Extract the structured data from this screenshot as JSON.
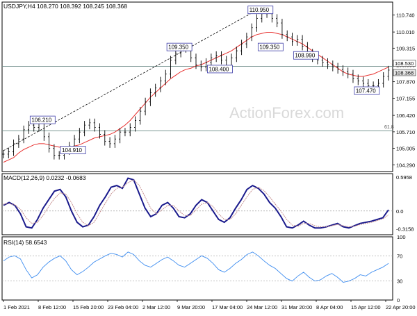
{
  "header": {
    "symbol_line": "USDJPY,H4  108.270 108.392 108.245 108.368",
    "watermark": "ActionForex.com"
  },
  "chart_data": [
    {
      "type": "candlestick",
      "panel": "price",
      "ylim": [
        104.29,
        110.74
      ],
      "y_ticks": [
        "110.740",
        "110.010",
        "109.315",
        "108.590",
        "107.870",
        "107.155",
        "106.420",
        "105.710",
        "105.005",
        "104.290"
      ],
      "price_labels": [
        "108.530",
        "108.368"
      ],
      "horizontal_lines": [
        {
          "value": 108.53,
          "color": "#6b8a86"
        },
        {
          "value": 105.76,
          "label": "61.8",
          "color": "#6b8a86"
        }
      ],
      "annotations": [
        {
          "text": "110.950",
          "x": "31 Mar",
          "value": 110.95
        },
        {
          "text": "109.350",
          "x": "3 Mar",
          "value": 109.35
        },
        {
          "text": "108.400",
          "x": "10 Mar",
          "value": 108.4
        },
        {
          "text": "109.350",
          "x": "1 Apr",
          "value": 109.35
        },
        {
          "text": "108.990",
          "x": "6 Apr",
          "value": 108.99
        },
        {
          "text": "107.470",
          "x": "23 Apr",
          "value": 107.47
        },
        {
          "text": "106.210",
          "x": "4 Feb",
          "value": 106.21
        },
        {
          "text": "104.910",
          "x": "12 Feb",
          "value": 104.91
        }
      ],
      "trendline": {
        "from": {
          "x": "1 Feb",
          "value": 104.9
        },
        "to": {
          "x": "30 Mar",
          "value": 110.95
        },
        "style": "dashed"
      },
      "series": [
        {
          "kind": "close",
          "color": "#000000",
          "values": [
            104.75,
            104.85,
            105.2,
            105.4,
            105.8,
            106.0,
            105.9,
            106.1,
            105.5,
            105.0,
            104.7,
            104.7,
            104.9,
            105.1,
            105.4,
            105.7,
            106.0,
            106.1,
            105.9,
            105.6,
            105.3,
            105.2,
            105.4,
            105.7,
            105.7,
            105.9,
            106.2,
            106.6,
            107.0,
            107.4,
            107.6,
            107.9,
            108.2,
            108.8,
            109.1,
            109.3,
            109.3,
            108.9,
            108.6,
            108.5,
            108.7,
            108.9,
            109.0,
            108.8,
            108.5,
            108.9,
            109.2,
            109.5,
            109.8,
            110.2,
            110.6,
            110.8,
            110.8,
            110.6,
            110.4,
            109.9,
            109.8,
            109.6,
            109.7,
            109.4,
            109.1,
            108.9,
            108.8,
            108.7,
            108.6,
            108.5,
            108.4,
            108.3,
            108.2,
            108.0,
            107.9,
            107.8,
            107.7,
            107.7,
            107.8,
            108.1,
            108.37
          ]
        },
        {
          "kind": "moving-average",
          "color": "#e8312f",
          "values": [
            104.4,
            104.5,
            104.6,
            104.8,
            104.95,
            105.05,
            105.15,
            105.2,
            105.2,
            105.15,
            105.1,
            105.05,
            105.05,
            105.05,
            105.1,
            105.15,
            105.25,
            105.35,
            105.45,
            105.5,
            105.55,
            105.6,
            105.7,
            105.85,
            106.0,
            106.2,
            106.45,
            106.7,
            106.95,
            107.2,
            107.4,
            107.6,
            107.8,
            108.0,
            108.15,
            108.3,
            108.4,
            108.45,
            108.55,
            108.6,
            108.7,
            108.8,
            108.9,
            109.0,
            109.1,
            109.2,
            109.35,
            109.5,
            109.65,
            109.8,
            109.9,
            109.95,
            110.0,
            110.0,
            109.95,
            109.9,
            109.8,
            109.7,
            109.6,
            109.5,
            109.35,
            109.2,
            109.05,
            108.9,
            108.75,
            108.6,
            108.45,
            108.3,
            108.2,
            108.15,
            108.1,
            108.1,
            108.15,
            108.2,
            108.3,
            108.4,
            108.5
          ]
        }
      ]
    },
    {
      "type": "line",
      "panel": "macd",
      "title": "MACD(12,26,9) 0.0232 -0.0683",
      "y_ticks": [
        "0.5958",
        "0.0",
        "-0.3158"
      ],
      "ylim": [
        -0.3158,
        0.5958
      ],
      "series": [
        {
          "kind": "macd",
          "color": "#1a1a8c",
          "values": [
            0.1,
            0.15,
            0.1,
            -0.05,
            -0.28,
            -0.3,
            -0.15,
            0.05,
            0.2,
            0.35,
            0.38,
            0.25,
            0.0,
            -0.2,
            -0.28,
            -0.25,
            -0.1,
            0.1,
            0.25,
            0.42,
            0.45,
            0.4,
            0.58,
            0.55,
            0.3,
            0.05,
            -0.1,
            -0.05,
            0.1,
            0.15,
            0.05,
            -0.1,
            -0.12,
            -0.05,
            0.1,
            0.2,
            0.15,
            0.0,
            -0.15,
            -0.2,
            -0.12,
            0.05,
            0.2,
            0.38,
            0.45,
            0.4,
            0.3,
            0.15,
            0.05,
            -0.1,
            -0.28,
            -0.3,
            -0.25,
            -0.18,
            -0.25,
            -0.3,
            -0.3,
            -0.28,
            -0.25,
            -0.22,
            -0.28,
            -0.3,
            -0.26,
            -0.22,
            -0.2,
            -0.18,
            -0.15,
            -0.12,
            0.02
          ]
        },
        {
          "kind": "signal",
          "color": "#c58f8f",
          "values": [
            0.12,
            0.13,
            0.11,
            0.03,
            -0.12,
            -0.22,
            -0.2,
            -0.08,
            0.08,
            0.22,
            0.32,
            0.3,
            0.15,
            -0.05,
            -0.2,
            -0.26,
            -0.2,
            -0.03,
            0.14,
            0.3,
            0.4,
            0.42,
            0.5,
            0.55,
            0.45,
            0.25,
            0.05,
            -0.05,
            0.02,
            0.1,
            0.1,
            0.0,
            -0.08,
            -0.08,
            0.02,
            0.12,
            0.15,
            0.08,
            -0.05,
            -0.15,
            -0.15,
            -0.05,
            0.1,
            0.25,
            0.38,
            0.42,
            0.36,
            0.25,
            0.12,
            0.0,
            -0.15,
            -0.25,
            -0.27,
            -0.22,
            -0.22,
            -0.26,
            -0.28,
            -0.28,
            -0.26,
            -0.24,
            -0.26,
            -0.28,
            -0.27,
            -0.24,
            -0.22,
            -0.2,
            -0.17,
            -0.14,
            -0.07
          ]
        }
      ]
    },
    {
      "type": "line",
      "panel": "rsi",
      "title": "RSI(14) 58.6543",
      "y_ticks": [
        "100",
        "70",
        "30",
        "0"
      ],
      "ylim": [
        0,
        100
      ],
      "levels": [
        70,
        30
      ],
      "series": [
        {
          "kind": "rsi",
          "color": "#3c8cf0",
          "values": [
            62,
            68,
            70,
            65,
            48,
            35,
            40,
            52,
            60,
            66,
            70,
            62,
            48,
            40,
            45,
            52,
            60,
            65,
            70,
            74,
            72,
            68,
            76,
            72,
            62,
            55,
            52,
            58,
            64,
            68,
            62,
            55,
            52,
            58,
            64,
            70,
            66,
            58,
            48,
            44,
            50,
            58,
            64,
            72,
            76,
            70,
            62,
            55,
            50,
            42,
            34,
            30,
            38,
            44,
            36,
            30,
            32,
            38,
            42,
            36,
            28,
            30,
            34,
            40,
            38,
            44,
            48,
            52,
            58
          ]
        }
      ]
    }
  ],
  "x_axis": {
    "labels": [
      "1 Feb 2021",
      "8 Feb 12:00",
      "15 Feb 20:00",
      "23 Feb 04:00",
      "2 Mar 12:00",
      "9 Mar 20:00",
      "17 Mar 04:00",
      "24 Mar 12:00",
      "31 Mar 20:00",
      "8 Apr 04:00",
      "15 Apr 12:00",
      "22 Apr 20:00"
    ]
  }
}
